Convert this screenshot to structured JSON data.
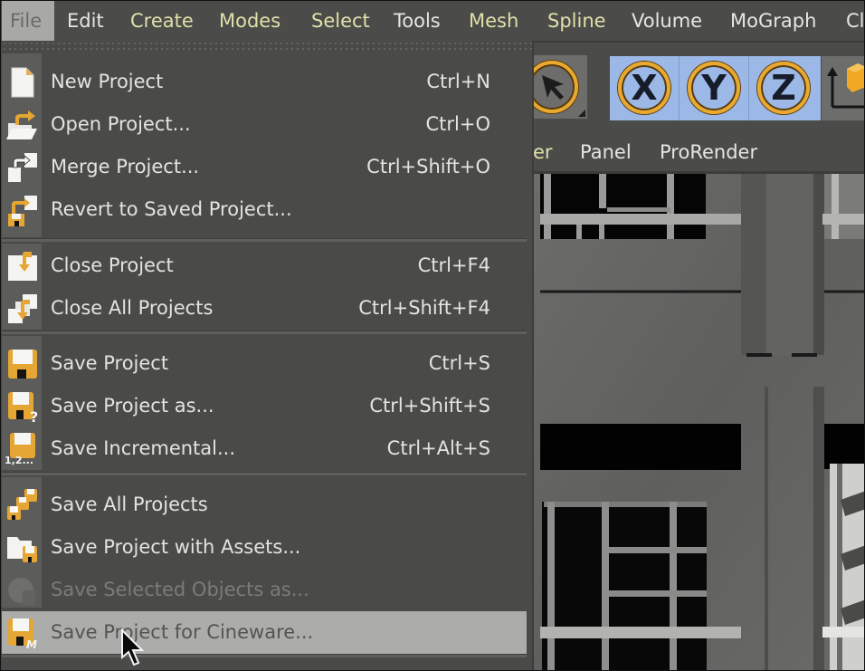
{
  "menubar": {
    "items": [
      {
        "label": "File",
        "active": true
      },
      {
        "label": "Edit"
      },
      {
        "label": "Create"
      },
      {
        "label": "Modes"
      },
      {
        "label": "Select"
      },
      {
        "label": "Tools"
      },
      {
        "label": "Mesh"
      },
      {
        "label": "Spline"
      },
      {
        "label": "Volume"
      },
      {
        "label": "MoGraph"
      },
      {
        "label": "Cl"
      }
    ]
  },
  "toolbar": {
    "select_tool_icon": "arrow-cursor-icon",
    "axis_locks": [
      {
        "label": "X",
        "active": true
      },
      {
        "label": "Y",
        "active": true
      },
      {
        "label": "Z",
        "active": true
      }
    ],
    "coordinate_system_icon": "world-coordinate-icon"
  },
  "secondary_menubar": {
    "items": [
      {
        "label": "er"
      },
      {
        "label": "Panel"
      },
      {
        "label": "ProRender"
      }
    ]
  },
  "file_menu": {
    "groups": [
      [
        {
          "label": "New Project",
          "shortcut": "Ctrl+N",
          "icon": "new-document-icon"
        },
        {
          "label": "Open Project...",
          "shortcut": "Ctrl+O",
          "icon": "open-folder-icon"
        },
        {
          "label": "Merge Project...",
          "shortcut": "Ctrl+Shift+O",
          "icon": "merge-icon"
        },
        {
          "label": "Revert to Saved Project...",
          "shortcut": "",
          "icon": "revert-icon"
        }
      ],
      [
        {
          "label": "Close Project",
          "shortcut": "Ctrl+F4",
          "icon": "close-document-icon"
        },
        {
          "label": "Close All Projects",
          "shortcut": "Ctrl+Shift+F4",
          "icon": "close-all-icon"
        }
      ],
      [
        {
          "label": "Save Project",
          "shortcut": "Ctrl+S",
          "icon": "floppy-disk-icon"
        },
        {
          "label": "Save Project as...",
          "shortcut": "Ctrl+Shift+S",
          "icon": "floppy-question-icon"
        },
        {
          "label": "Save Incremental...",
          "shortcut": "Ctrl+Alt+S",
          "icon": "floppy-incremental-icon",
          "badge": "1,2..."
        }
      ],
      [
        {
          "label": "Save All Projects",
          "shortcut": "",
          "icon": "floppy-stack-icon"
        },
        {
          "label": "Save Project with Assets...",
          "shortcut": "",
          "icon": "folder-floppy-icon"
        },
        {
          "label": "Save Selected Objects as...",
          "shortcut": "",
          "icon": "save-objects-icon",
          "disabled": true
        },
        {
          "label": "Save Project for Cineware...",
          "shortcut": "",
          "icon": "floppy-cineware-icon",
          "hovered": true,
          "badge": "M"
        }
      ]
    ]
  },
  "colors": {
    "accent_orange": "#e9a92f",
    "axis_active_bg": "#9cb8e6",
    "menu_bg": "#4a4a48",
    "hover_bg": "#acacaa",
    "menubar_yellow_text": "#dfe0a9"
  }
}
